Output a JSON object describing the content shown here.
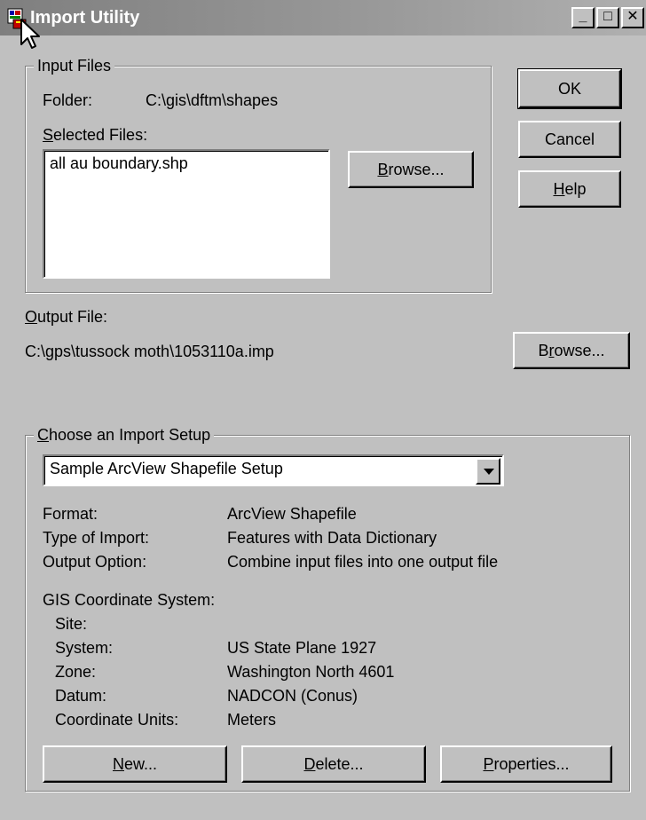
{
  "window": {
    "title": "Import Utility",
    "minimize_glyph": "_",
    "maximize_glyph": "□",
    "close_glyph": "✕"
  },
  "input_files": {
    "legend": "Input Files",
    "folder_label": "Folder:",
    "folder_value": "C:\\gis\\dftm\\shapes",
    "selected_files_label_rest": "elected Files:",
    "selected_files_accel": "S",
    "selected_files": [
      "all au boundary.shp"
    ],
    "browse_accel": "B",
    "browse_rest": "rowse..."
  },
  "buttons": {
    "ok": "OK",
    "cancel": "Cancel",
    "help_accel": "H",
    "help_rest": "elp"
  },
  "output_file": {
    "label_accel": "O",
    "label_rest": "utput File:",
    "path": "C:\\gps\\tussock moth\\1053110a.imp",
    "browse_pre": "B",
    "browse_accel": "r",
    "browse_rest": "owse..."
  },
  "import_setup": {
    "legend_accel": "C",
    "legend_rest": "hoose an Import Setup",
    "selected_setup": "Sample ArcView Shapefile Setup",
    "format_label": "Format:",
    "format_value": "ArcView Shapefile",
    "type_label": "Type of Import:",
    "type_value": "Features with Data Dictionary",
    "output_option_label": "Output Option:",
    "output_option_value": "Combine input files into one output file",
    "gis_label": "GIS Coordinate System:",
    "site_label": "Site:",
    "site_value": "",
    "system_label": "System:",
    "system_value": "US State Plane 1927",
    "zone_label": "Zone:",
    "zone_value": "Washington North 4601",
    "datum_label": "Datum:",
    "datum_value": "NADCON (Conus)",
    "units_label": "Coordinate Units:",
    "units_value": "Meters",
    "new_accel": "N",
    "new_rest": "ew...",
    "delete_accel": "D",
    "delete_rest": "elete...",
    "properties_accel": "P",
    "properties_rest": "roperties..."
  },
  "colors": {
    "face": "#c0c0c0",
    "titlebar": "#808080",
    "title_text": "#ffffff"
  }
}
